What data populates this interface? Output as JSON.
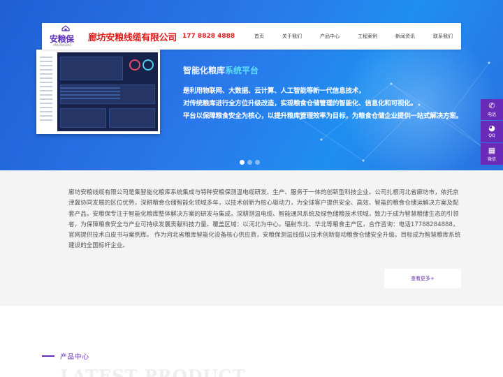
{
  "header": {
    "brand": "安粮保",
    "brand_sub": "ANLIANGBAO",
    "company": "廊坊安粮线缆有限公司",
    "phone": "177 8828 4888",
    "nav": [
      "首页",
      "关于我们",
      "产品中心",
      "工程案例",
      "新闻资讯",
      "联系我们"
    ]
  },
  "hero": {
    "title_a": "智能化粮库",
    "title_b": "系统平台",
    "lines": [
      "是利用物联网、大数据、云计算、人工智能等新一代信息技术，",
      "对传统粮库进行全方位升级改造，实现粮食仓储管理的智能化、信息化和可视化。",
      "平台以保障粮食安全为核心，以提升粮库管理效率为目标，为粮食仓储企业提供一站式解决方案。"
    ],
    "slides": 3,
    "active_slide": 0
  },
  "float": [
    {
      "icon": "phone-icon",
      "glyph": "✆",
      "label": "电话"
    },
    {
      "icon": "qq-icon",
      "glyph": "◕",
      "label": "QQ"
    },
    {
      "icon": "qrcode-icon",
      "glyph": "▦",
      "label": "微信"
    }
  ],
  "about": {
    "text": "廊坊安粮线缆有限公司是集智能化粮库系统集成与特种安粮保测温电缆研发、生产、服务于一体的创新型科技企业。公司扎根河北省廊坊市，依托京津冀协同发展的区位优势，深耕粮食仓储智能化领域多年，以技术创新为核心驱动力，为全球客户提供安全、高效、智能的粮食仓储运解决方案及配套产品，安粮保专注于智能化粮库整体解决方案的研发与集成，深耕测温电缆、智能通风系统及绿色储粮技术领域，致力于成为智慧粮储生态的引领者，为保障粮食安全与产业可持续发展贡献科技力量。覆盖区域：以河北为中心，辐射东北、华北等粮食主产区，合作咨询：电话17788284888，官网提供技术白皮书与案例库。 作为河北省粮库智能化设备核心供应商，安粮保测温线缆以技术创新驱动粮食仓储安全升级，目标成为智慧粮库系统建设的全国标杆企业。",
    "more_label": "查看更多+"
  },
  "products": {
    "title": "产品中心",
    "subtitle": "LATEST PRODUCT"
  },
  "colors": {
    "accent": "#6a2bb8",
    "brand_red": "#e01b1b",
    "hero_blue": "#2a78ea"
  }
}
